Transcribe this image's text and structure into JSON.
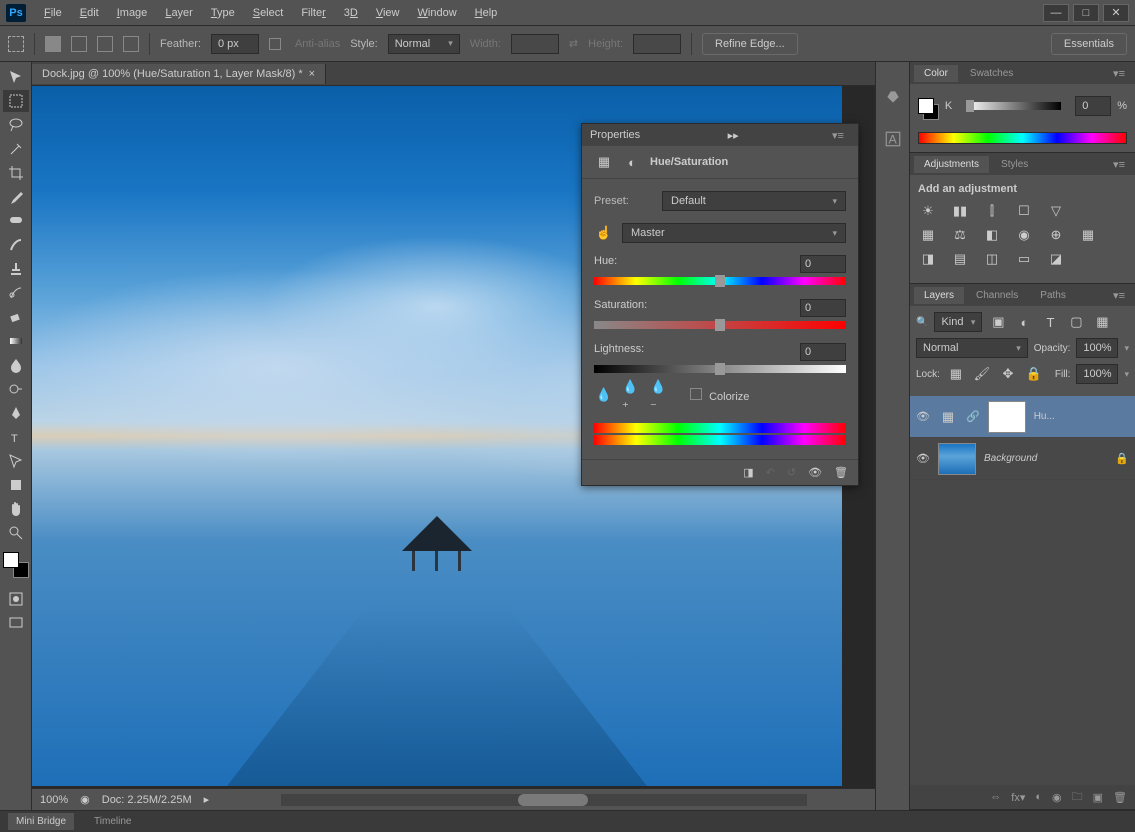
{
  "menus": [
    "File",
    "Edit",
    "Image",
    "Layer",
    "Type",
    "Select",
    "Filter",
    "3D",
    "View",
    "Window",
    "Help"
  ],
  "optbar": {
    "feather": "Feather:",
    "feather_val": "0 px",
    "antialias": "Anti-alias",
    "style": "Style:",
    "style_val": "Normal",
    "width": "Width:",
    "height": "Height:",
    "refine": "Refine Edge...",
    "essentials": "Essentials"
  },
  "tab_title": "Dock.jpg @ 100% (Hue/Saturation 1, Layer Mask/8) *",
  "status": {
    "zoom": "100%",
    "doc": "Doc: 2.25M/2.25M"
  },
  "bottom": {
    "minibridge": "Mini Bridge",
    "timeline": "Timeline"
  },
  "panels": {
    "color": {
      "tab1": "Color",
      "tab2": "Swatches",
      "k": "K",
      "kval": "0",
      "pct": "%"
    },
    "adjustments": {
      "tab1": "Adjustments",
      "tab2": "Styles",
      "add": "Add an adjustment"
    },
    "layers": {
      "tab1": "Layers",
      "tab2": "Channels",
      "tab3": "Paths",
      "kind": "Kind",
      "normal": "Normal",
      "opacity": "Opacity:",
      "opacity_val": "100%",
      "lock": "Lock:",
      "fill": "Fill:",
      "fill_val": "100%",
      "layer1": "Hu...",
      "layer2": "Background"
    }
  },
  "properties": {
    "title": "Properties",
    "subtitle": "Hue/Saturation",
    "preset": "Preset:",
    "preset_val": "Default",
    "master": "Master",
    "hue": "Hue:",
    "hue_val": "0",
    "sat": "Saturation:",
    "sat_val": "0",
    "lig": "Lightness:",
    "lig_val": "0",
    "colorize": "Colorize"
  }
}
